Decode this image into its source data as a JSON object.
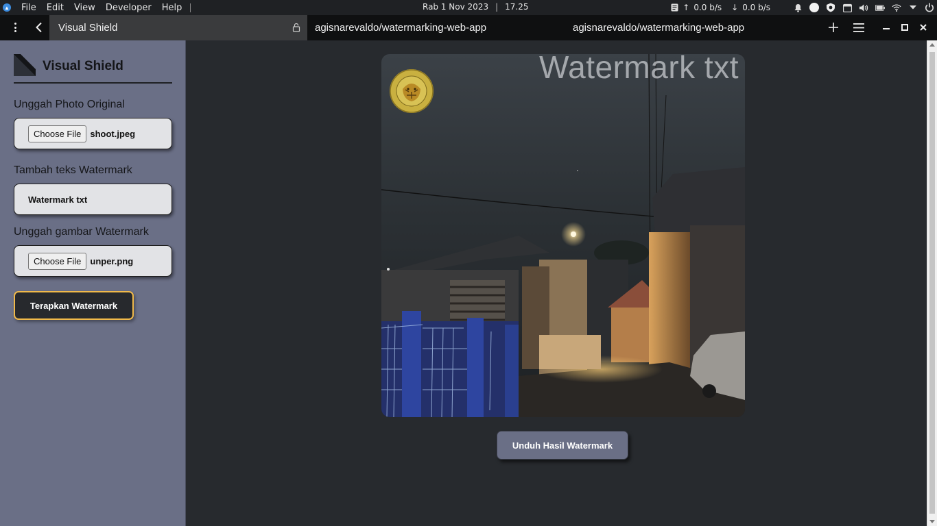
{
  "system_bar": {
    "menu": [
      "File",
      "Edit",
      "View",
      "Developer",
      "Help"
    ],
    "date": "Rab 1 Nov 2023",
    "time": "17.25",
    "net_up": "0.0 b/s",
    "net_down": "0.0 b/s",
    "up_arrow": "↑",
    "down_arrow": "↓"
  },
  "browser": {
    "app_title": "Visual Shield",
    "url": "agisnarevaldo/watermarking-web-app",
    "page_title": "agisnarevaldo/watermarking-web-app"
  },
  "sidebar": {
    "brand": "Visual Shield",
    "original_label": "Unggah Photo Original",
    "original_button": "Choose File",
    "original_file": "shoot.jpeg",
    "text_label": "Tambah teks Watermark",
    "text_value": "Watermark txt",
    "image_label": "Unggah gambar Watermark",
    "image_button": "Choose File",
    "image_file": "unper.png",
    "apply_button": "Terapkan Watermark"
  },
  "preview": {
    "watermark_text": "Watermark txt",
    "download_button": "Unduh Hasil Watermark"
  },
  "colors": {
    "sidebar_bg": "#6a6f86",
    "main_bg": "#272a2e",
    "accent_border": "#f0b94a",
    "card_bg": "#e2e3e6"
  }
}
